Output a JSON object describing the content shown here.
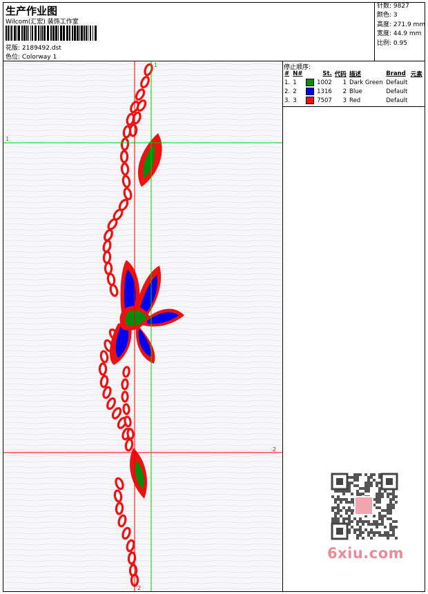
{
  "header": {
    "title": "生产作业图",
    "subtitle": "Wilcom(汇宏) 装饰工作室",
    "pattern_label": "花版:",
    "pattern_value": "2189492.dst",
    "colorway_label": "色位:",
    "colorway_value": "Colorway 1"
  },
  "stats": {
    "stitches_label": "针数:",
    "stitches_value": "9827",
    "colors_label": "颜色:",
    "colors_value": "3",
    "height_label": "高度:",
    "height_value": "271.9 mm",
    "width_label": "宽度:",
    "width_value": "44.9 mm",
    "scale_label": "比例:",
    "scale_value": "0.95"
  },
  "stop_sequence": {
    "title": "停止顺序:",
    "columns": [
      "#",
      "N#",
      "St.",
      "代码",
      "描述",
      "Brand",
      "元素"
    ],
    "rows": [
      {
        "idx": "1.",
        "n": "1",
        "color": "#0a8a0a",
        "stitches": "1002",
        "code": "1",
        "desc": "Dark Green",
        "brand": "Default"
      },
      {
        "idx": "2.",
        "n": "2",
        "color": "#0000ee",
        "stitches": "1316",
        "code": "2",
        "desc": "Blue",
        "brand": "Default"
      },
      {
        "idx": "3.",
        "n": "3",
        "color": "#ee1111",
        "stitches": "7507",
        "code": "3",
        "desc": "Red",
        "brand": "Default"
      }
    ]
  },
  "guides": {
    "green_v_label": "1",
    "green_h_label": "1",
    "red_h_label": "2",
    "red_v_label": "2",
    "green_color": "#00cc00",
    "red_color": "#ee0000"
  },
  "design_colors": {
    "red": "#ee1111",
    "green": "#0a8a0a",
    "blue": "#0000ee"
  },
  "watermark": {
    "text": "6xiu.com"
  }
}
